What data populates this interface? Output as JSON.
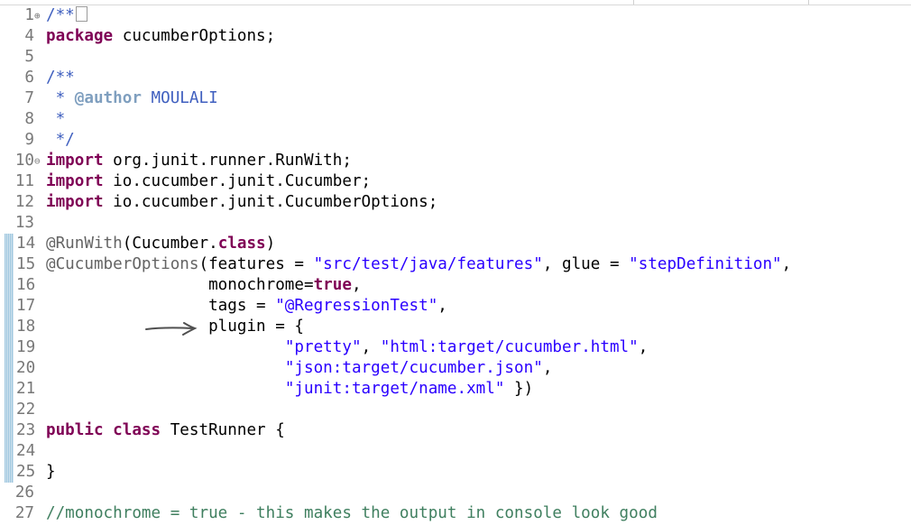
{
  "lines": [
    {
      "num": "1",
      "fold": "⊕",
      "parts": [
        {
          "t": "/**",
          "c": "doc"
        }
      ],
      "collapsed_box": true
    },
    {
      "num": "4",
      "parts": [
        {
          "t": "package",
          "c": "kw"
        },
        {
          "t": " cucumberOptions;",
          "c": ""
        }
      ]
    },
    {
      "num": "5",
      "parts": []
    },
    {
      "num": "6",
      "parts": [
        {
          "t": "/**",
          "c": "doc"
        }
      ]
    },
    {
      "num": "7",
      "parts": [
        {
          "t": " * ",
          "c": "doc"
        },
        {
          "t": "@author",
          "c": "doctag"
        },
        {
          "t": " MOULALI",
          "c": "doc"
        }
      ]
    },
    {
      "num": "8",
      "parts": [
        {
          "t": " *",
          "c": "doc"
        }
      ]
    },
    {
      "num": "9",
      "parts": [
        {
          "t": " */",
          "c": "doc"
        }
      ]
    },
    {
      "num": "10",
      "fold": "⊖",
      "parts": [
        {
          "t": "import",
          "c": "kw"
        },
        {
          "t": " org.junit.runner.RunWith;",
          "c": ""
        }
      ]
    },
    {
      "num": "11",
      "parts": [
        {
          "t": "import",
          "c": "kw"
        },
        {
          "t": " io.cucumber.junit.Cucumber;",
          "c": ""
        }
      ]
    },
    {
      "num": "12",
      "parts": [
        {
          "t": "import",
          "c": "kw"
        },
        {
          "t": " io.cucumber.junit.CucumberOptions;",
          "c": ""
        }
      ]
    },
    {
      "num": "13",
      "parts": []
    },
    {
      "num": "14",
      "bar": true,
      "parts": [
        {
          "t": "@RunWith",
          "c": "ann"
        },
        {
          "t": "(Cucumber.",
          "c": ""
        },
        {
          "t": "class",
          "c": "kw"
        },
        {
          "t": ")",
          "c": ""
        }
      ]
    },
    {
      "num": "15",
      "bar": true,
      "parts": [
        {
          "t": "@CucumberOptions",
          "c": "ann"
        },
        {
          "t": "(features = ",
          "c": ""
        },
        {
          "t": "\"src/test/java/features\"",
          "c": "str"
        },
        {
          "t": ", glue = ",
          "c": ""
        },
        {
          "t": "\"stepDefinition\"",
          "c": "str"
        },
        {
          "t": ",",
          "c": ""
        }
      ]
    },
    {
      "num": "16",
      "bar": true,
      "parts": [
        {
          "t": "                 monochrome=",
          "c": ""
        },
        {
          "t": "true",
          "c": "kw"
        },
        {
          "t": ",",
          "c": ""
        }
      ]
    },
    {
      "num": "17",
      "bar": true,
      "parts": [
        {
          "t": "                 tags = ",
          "c": ""
        },
        {
          "t": "\"@RegressionTest\"",
          "c": "str"
        },
        {
          "t": ",",
          "c": ""
        }
      ]
    },
    {
      "num": "18",
      "bar": true,
      "parts": [
        {
          "t": "                 plugin = {",
          "c": ""
        }
      ]
    },
    {
      "num": "19",
      "bar": true,
      "parts": [
        {
          "t": "                         ",
          "c": ""
        },
        {
          "t": "\"pretty\"",
          "c": "str"
        },
        {
          "t": ", ",
          "c": ""
        },
        {
          "t": "\"html:target/cucumber.html\"",
          "c": "str"
        },
        {
          "t": ",",
          "c": ""
        }
      ]
    },
    {
      "num": "20",
      "bar": true,
      "parts": [
        {
          "t": "                         ",
          "c": ""
        },
        {
          "t": "\"json:target/cucumber.json\"",
          "c": "str"
        },
        {
          "t": ",",
          "c": ""
        }
      ]
    },
    {
      "num": "21",
      "bar": true,
      "parts": [
        {
          "t": "                         ",
          "c": ""
        },
        {
          "t": "\"junit:target/name.xml\"",
          "c": "str"
        },
        {
          "t": " })",
          "c": ""
        }
      ]
    },
    {
      "num": "22",
      "bar": true,
      "parts": []
    },
    {
      "num": "23",
      "bar": true,
      "parts": [
        {
          "t": "public",
          "c": "kw"
        },
        {
          "t": " ",
          "c": ""
        },
        {
          "t": "class",
          "c": "kw"
        },
        {
          "t": " TestRunner {",
          "c": ""
        }
      ]
    },
    {
      "num": "24",
      "bar": true,
      "parts": []
    },
    {
      "num": "25",
      "bar": true,
      "parts": [
        {
          "t": "}",
          "c": ""
        }
      ]
    },
    {
      "num": "26",
      "parts": []
    },
    {
      "num": "27",
      "parts": [
        {
          "t": "//monochrome = true - this makes the output in console look good",
          "c": "cmt"
        }
      ]
    }
  ],
  "colors": {
    "keyword": "#7f0055",
    "string": "#2a00ff",
    "annotation": "#646464",
    "javadoc": "#3f5fbf",
    "javadoc_tag": "#7f9fbf",
    "comment": "#3f7f5f",
    "line_number": "#787878",
    "change_bar": "#9fc7df"
  },
  "icons": {
    "fold_expand": "plus-circle-icon",
    "fold_collapse": "minus-circle-icon",
    "annotation_arrow": "hand-drawn-arrow-icon"
  }
}
